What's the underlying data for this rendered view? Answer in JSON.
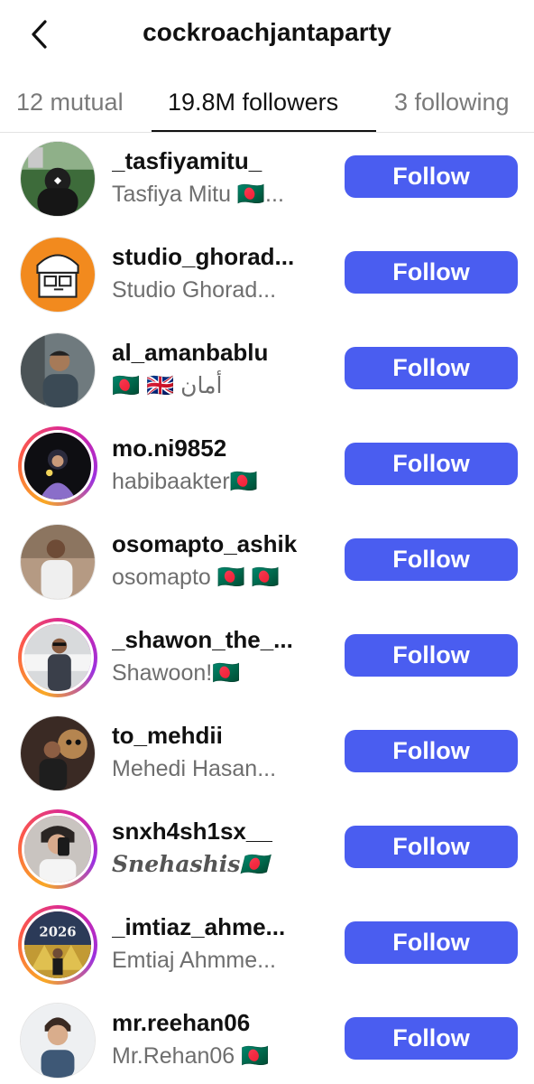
{
  "header": {
    "title": "cockroachjantaparty",
    "back_icon": "chevron-left-icon"
  },
  "tabs": [
    {
      "label": "12 mutual",
      "active": false
    },
    {
      "label": "19.8M followers",
      "active": true
    },
    {
      "label": "3 following",
      "active": false
    }
  ],
  "colors": {
    "follow_button": "#4a5df0",
    "muted_text": "#6e6e6e",
    "story_ring": "#d6249f"
  },
  "followers": [
    {
      "username": "_tasfiyamitu_",
      "full_name": "Tasfiya Mitu 🇧🇩...",
      "button": "Follow",
      "story_ring": false
    },
    {
      "username": "studio_ghorad...",
      "full_name": "Studio Ghorad...",
      "button": "Follow",
      "story_ring": false
    },
    {
      "username": "al_amanbablu",
      "full_name": "🇧🇩 🇬🇧 أمان",
      "button": "Follow",
      "story_ring": false
    },
    {
      "username": "mo.ni9852",
      "full_name": "habibaakter🇧🇩",
      "button": "Follow",
      "story_ring": true
    },
    {
      "username": "osomapto_ashik",
      "full_name": "osomapto 🇧🇩 🇧🇩",
      "button": "Follow",
      "story_ring": false
    },
    {
      "username": "_shawon_the_...",
      "full_name": "Shawoon!🇧🇩",
      "button": "Follow",
      "story_ring": true
    },
    {
      "username": "to_mehdii",
      "full_name": "Mehedi Hasan...",
      "button": "Follow",
      "story_ring": false
    },
    {
      "username": "snxh4sh1sx__",
      "full_name": "Snehashis🇧🇩",
      "button": "Follow",
      "story_ring": true
    },
    {
      "username": "_imtiaz_ahme...",
      "full_name": "Emtiaj Ahmme...",
      "button": "Follow",
      "story_ring": true,
      "avatar_text": "2026"
    },
    {
      "username": "mr.reehan06",
      "full_name": "Mr.Rehan06 🇧🇩",
      "button": "Follow",
      "story_ring": false
    }
  ]
}
